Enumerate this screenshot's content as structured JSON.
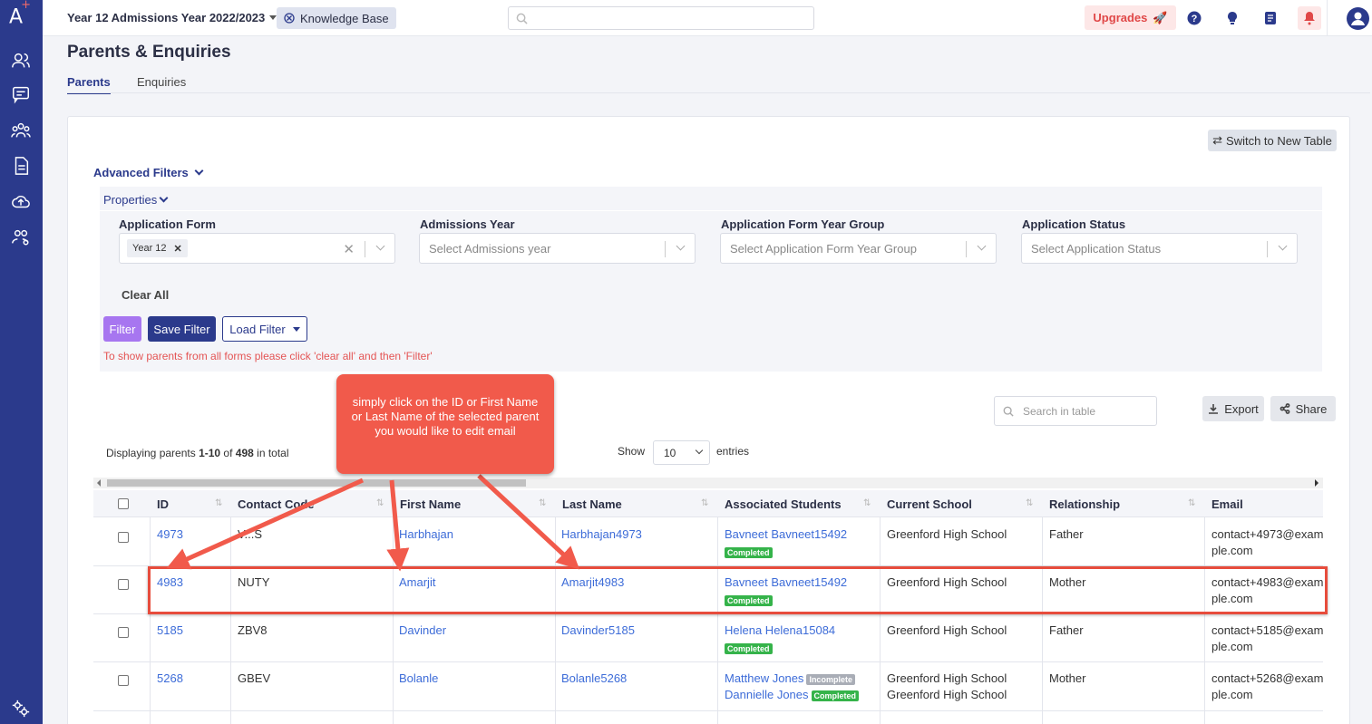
{
  "app": {
    "logo": "A",
    "logo_sup": "+"
  },
  "topbar": {
    "year_selector": "Year 12 Admissions Year 2022/2023",
    "knowledge_base": "Knowledge Base",
    "upgrades": "Upgrades"
  },
  "page": {
    "title": "Parents & Enquiries",
    "tabs": [
      "Parents",
      "Enquiries"
    ]
  },
  "toolbar": {
    "switch_table": "Switch to New Table"
  },
  "filters": {
    "advanced_label": "Advanced Filters",
    "properties_label": "Properties",
    "fields": [
      {
        "label": "Application Form",
        "value": "Year 12",
        "placeholder": ""
      },
      {
        "label": "Admissions Year",
        "value": "",
        "placeholder": "Select Admissions year"
      },
      {
        "label": "Application Form Year Group",
        "value": "",
        "placeholder": "Select Application Form Year Group"
      },
      {
        "label": "Application Status",
        "value": "",
        "placeholder": "Select Application Status"
      }
    ],
    "clear_all": "Clear All",
    "filter_btn": "Filter",
    "save_filter_btn": "Save Filter",
    "load_filter_btn": "Load Filter",
    "hint": "To show parents from all forms please click 'clear all' and then 'Filter'"
  },
  "table_tools": {
    "search_placeholder": "Search in table",
    "export": "Export",
    "share": "Share",
    "displaying_prefix": "Displaying parents ",
    "displaying_range": "1-10",
    "displaying_of": " of ",
    "displaying_total": "498",
    "displaying_suffix": " in total",
    "show_label": "Show",
    "show_value": "10",
    "entries_label": "entries"
  },
  "table": {
    "columns": [
      "ID",
      "Contact Code",
      "First Name",
      "Last Name",
      "Associated Students",
      "Current School",
      "Relationship",
      "Email"
    ],
    "rows": [
      {
        "id": "4973",
        "code": "V...S",
        "first": "Harbhajan",
        "last": "Harbhajan4973",
        "students": [
          {
            "name": "Bavneet Bavneet15492",
            "status": "Completed"
          }
        ],
        "schools": [
          "Greenford High School"
        ],
        "relationship": "Father",
        "email": "contact+4973@example.com"
      },
      {
        "id": "4983",
        "code": "NUTY",
        "first": "Amarjit",
        "last": "Amarjit4983",
        "students": [
          {
            "name": "Bavneet Bavneet15492",
            "status": "Completed"
          }
        ],
        "schools": [
          "Greenford High School"
        ],
        "relationship": "Mother",
        "email": "contact+4983@example.com"
      },
      {
        "id": "5185",
        "code": "ZBV8",
        "first": "Davinder",
        "last": "Davinder5185",
        "students": [
          {
            "name": "Helena Helena15084",
            "status": "Completed"
          }
        ],
        "schools": [
          "Greenford High School"
        ],
        "relationship": "Father",
        "email": "contact+5185@example.com"
      },
      {
        "id": "5268",
        "code": "GBEV",
        "first": "Bolanle",
        "last": "Bolanle5268",
        "students": [
          {
            "name": "Matthew Jones",
            "status": "Incomplete"
          },
          {
            "name": "Dannielle Jones",
            "status": "Completed"
          }
        ],
        "schools": [
          "Greenford High School",
          "Greenford High School"
        ],
        "relationship": "Mother",
        "email": "contact+5268@example.com"
      }
    ]
  },
  "annotation": {
    "text": "simply click on the ID or First Name or Last Name of the selected parent you would like to edit email"
  },
  "colors": {
    "sidebar": "#2b3a8c",
    "link": "#3d6cd8",
    "annotation": "#f15a4b",
    "filter_button": "#a776f0",
    "completed_badge": "#35b34a",
    "incomplete_badge": "#a9adb6"
  }
}
